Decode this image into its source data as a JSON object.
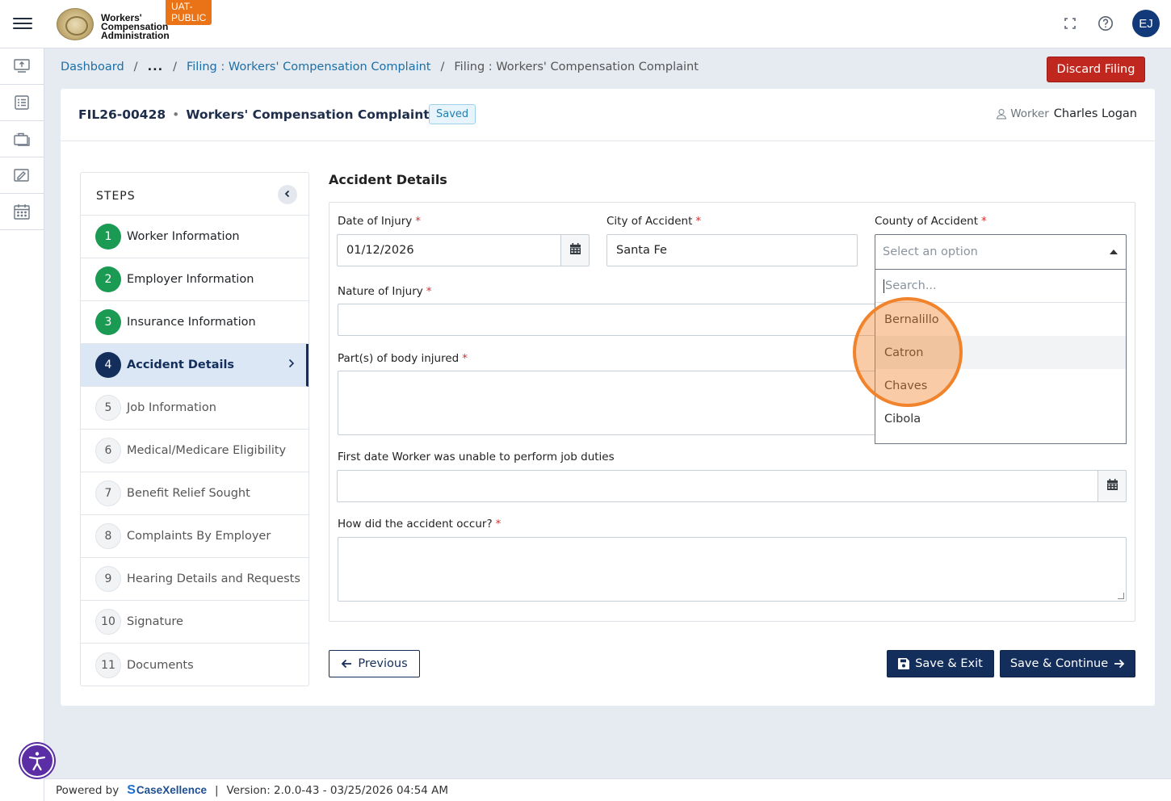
{
  "header": {
    "env_badge": "UAT-PUBLIC",
    "logo_lines": [
      "Workers'",
      "Compensation",
      "Administration"
    ],
    "avatar_initials": "EJ"
  },
  "breadcrumb": {
    "items": [
      "Dashboard",
      "...",
      "Filing : Workers' Compensation Complaint",
      "Filing : Workers' Compensation Complaint"
    ],
    "separator": "/"
  },
  "discard_label": "Discard Filing",
  "filing": {
    "id": "FIL26-00428",
    "separator": "•",
    "title": "Workers' Compensation Complaint",
    "status": "Saved",
    "worker_label": "Worker",
    "worker_name": "Charles Logan"
  },
  "steps": {
    "heading": "STEPS",
    "items": [
      {
        "num": "1",
        "label": "Worker Information",
        "state": "done"
      },
      {
        "num": "2",
        "label": "Employer Information",
        "state": "done"
      },
      {
        "num": "3",
        "label": "Insurance Information",
        "state": "done"
      },
      {
        "num": "4",
        "label": "Accident Details",
        "state": "active"
      },
      {
        "num": "5",
        "label": "Job Information",
        "state": "todo"
      },
      {
        "num": "6",
        "label": "Medical/Medicare Eligibility",
        "state": "todo"
      },
      {
        "num": "7",
        "label": "Benefit Relief Sought",
        "state": "todo"
      },
      {
        "num": "8",
        "label": "Complaints By Employer",
        "state": "todo"
      },
      {
        "num": "9",
        "label": "Hearing Details and Requests",
        "state": "todo"
      },
      {
        "num": "10",
        "label": "Signature",
        "state": "todo"
      },
      {
        "num": "11",
        "label": "Documents",
        "state": "todo"
      }
    ]
  },
  "form": {
    "section_title": "Accident Details",
    "required_mark": "*",
    "date_of_injury": {
      "label": "Date of Injury",
      "value": "01/12/2026"
    },
    "city": {
      "label": "City of Accident",
      "value": "Santa Fe"
    },
    "county": {
      "label": "County of Accident",
      "placeholder": "Select an option",
      "search_placeholder": "Search...",
      "options": [
        "Bernalillo",
        "Catron",
        "Chaves",
        "Cibola"
      ]
    },
    "nature": {
      "label": "Nature of Injury",
      "value": ""
    },
    "body_parts": {
      "label": "Part(s) of body injured",
      "value": ""
    },
    "first_date": {
      "label": "First date Worker was unable to perform job duties",
      "value": ""
    },
    "how": {
      "label": "How did the accident occur?",
      "value": ""
    }
  },
  "buttons": {
    "previous": "Previous",
    "save_exit": "Save & Exit",
    "save_continue": "Save & Continue"
  },
  "footer": {
    "powered_by": "Powered by",
    "brand": "CaseXellence",
    "divider": "|",
    "version": "Version: 2.0.0-43 - 03/25/2026 04:54 AM"
  },
  "colors": {
    "primary": "#142e5c",
    "success": "#1a9a53",
    "danger": "#c0281f",
    "highlight": "#f0832b",
    "badge": "#e97316"
  }
}
